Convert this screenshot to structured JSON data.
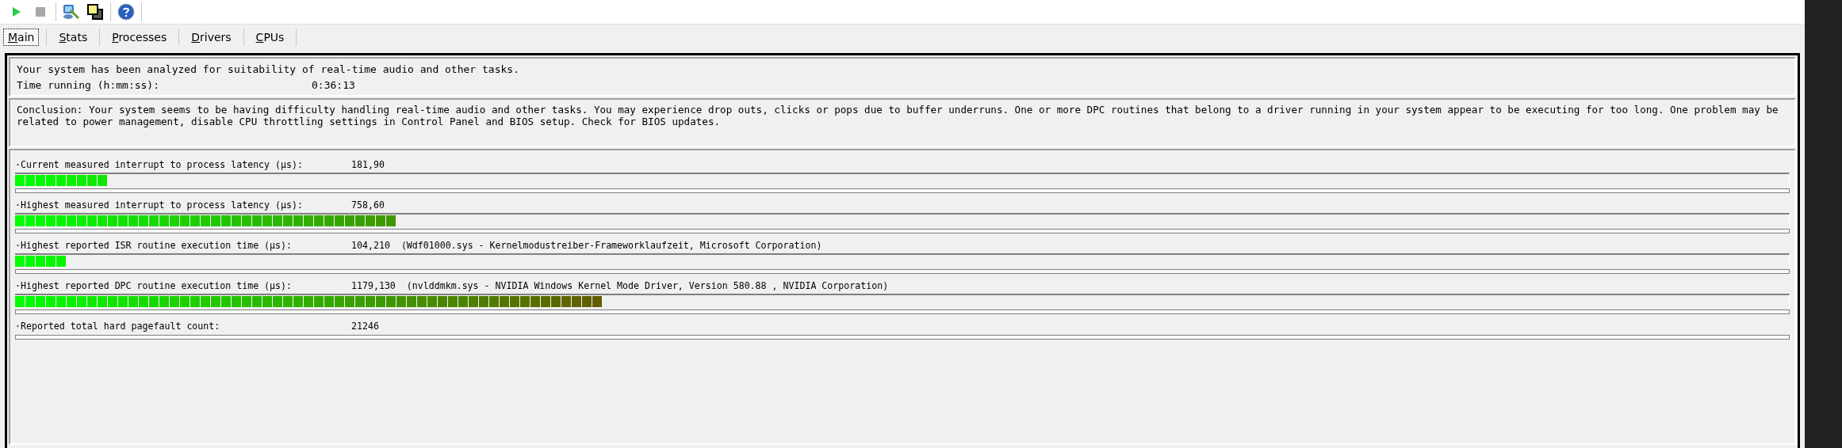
{
  "toolbar": {
    "buttons": [
      {
        "kind": "play",
        "disabled": false
      },
      {
        "kind": "stop",
        "disabled": true
      },
      {
        "kind": "analyze"
      },
      {
        "kind": "windows"
      },
      {
        "kind": "help"
      }
    ]
  },
  "tabs": [
    {
      "label": "Main",
      "selected": true
    },
    {
      "label": "Stats",
      "selected": false
    },
    {
      "label": "Processes",
      "selected": false
    },
    {
      "label": "Drivers",
      "selected": false
    },
    {
      "label": "CPUs",
      "selected": false
    }
  ],
  "summary": {
    "analyzed": "Your system has been analyzed for suitability of real-time audio and other tasks.",
    "time_label": "Time running (h:mm:ss):",
    "time_value": "0:36:13"
  },
  "conclusion": "Conclusion: Your system seems to be having difficulty handling real-time audio and other tasks. You may experience drop outs, clicks or pops due to buffer underruns. One or more DPC routines that belong to a driver running in your system appear to be executing for too long. One problem may be related to power management, disable CPU throttling settings in Control Panel and BIOS setup. Check for BIOS updates.",
  "metrics": [
    {
      "kind": "meter",
      "label": "·Current measured interrupt to process latency (µs):",
      "value": "181,90"
    },
    {
      "kind": "meter",
      "label": "·Highest measured interrupt to process latency (µs):",
      "value": "758,60"
    },
    {
      "kind": "meter",
      "label": "·Highest reported ISR routine execution time (µs):",
      "value": "104,210",
      "detail": "(Wdf01000.sys - Kernelmodustreiber-Frameworklaufzeit, Microsoft Corporation)"
    },
    {
      "kind": "meter",
      "label": "·Highest reported DPC routine execution time (µs):",
      "value": "1179,130",
      "detail": "(nvlddmkm.sys - NVIDIA Windows Kernel Mode Driver, Version 580.88 , NVIDIA Corporation)"
    },
    {
      "kind": "count",
      "label": "·Reported total hard pagefault count:",
      "value": "21246"
    }
  ]
}
